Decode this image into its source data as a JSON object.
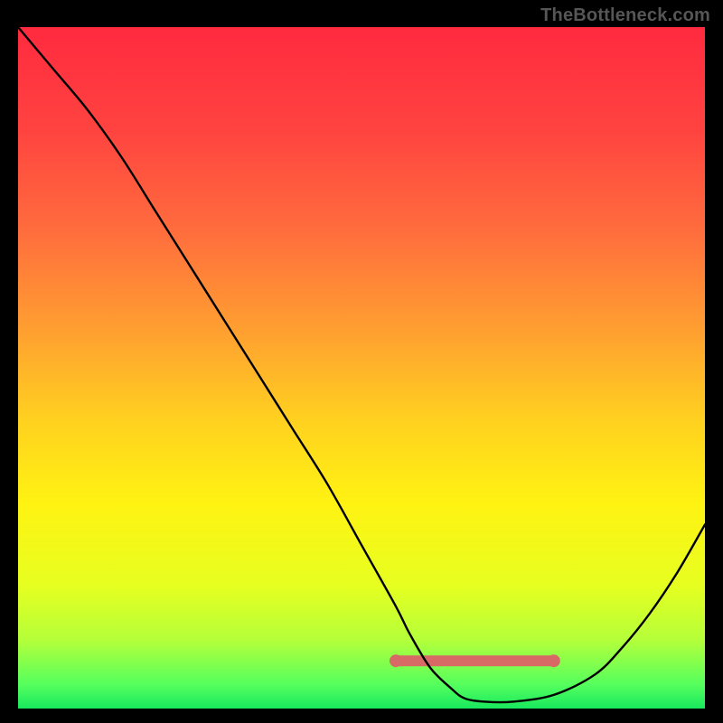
{
  "watermark_text": "TheBottleneck.com",
  "chart_data": {
    "type": "line",
    "title": "",
    "xlabel": "",
    "ylabel": "",
    "xlim": [
      0,
      100
    ],
    "ylim": [
      0,
      100
    ],
    "axes_visible": false,
    "series": [
      {
        "name": "bottleneck-curve",
        "x": [
          0,
          5,
          10,
          15,
          20,
          25,
          30,
          35,
          40,
          45,
          50,
          55,
          57,
          60,
          63,
          65,
          68,
          72,
          78,
          84,
          88,
          92,
          96,
          100
        ],
        "y": [
          100,
          94,
          88,
          81,
          73,
          65,
          57,
          49,
          41,
          33,
          24,
          15,
          11,
          6,
          3,
          1.5,
          1,
          1,
          2,
          5,
          9,
          14,
          20,
          27
        ]
      }
    ],
    "highlight_band": {
      "x_start": 55,
      "x_end": 78,
      "y": 7
    },
    "highlight_dots": [
      {
        "x": 55,
        "y": 7
      },
      {
        "x": 78,
        "y": 7
      }
    ],
    "gradient_stops": [
      {
        "offset": 0.0,
        "color": "#ff2a3f"
      },
      {
        "offset": 0.15,
        "color": "#ff4340"
      },
      {
        "offset": 0.3,
        "color": "#ff6d3d"
      },
      {
        "offset": 0.45,
        "color": "#ffa130"
      },
      {
        "offset": 0.58,
        "color": "#ffd21f"
      },
      {
        "offset": 0.7,
        "color": "#fff312"
      },
      {
        "offset": 0.82,
        "color": "#e6ff20"
      },
      {
        "offset": 0.9,
        "color": "#b4ff3a"
      },
      {
        "offset": 0.965,
        "color": "#55ff5e"
      },
      {
        "offset": 1.0,
        "color": "#18e85e"
      }
    ],
    "colors": {
      "curve": "#000000",
      "highlight": "#d86a65",
      "background_border": "#000000"
    }
  }
}
